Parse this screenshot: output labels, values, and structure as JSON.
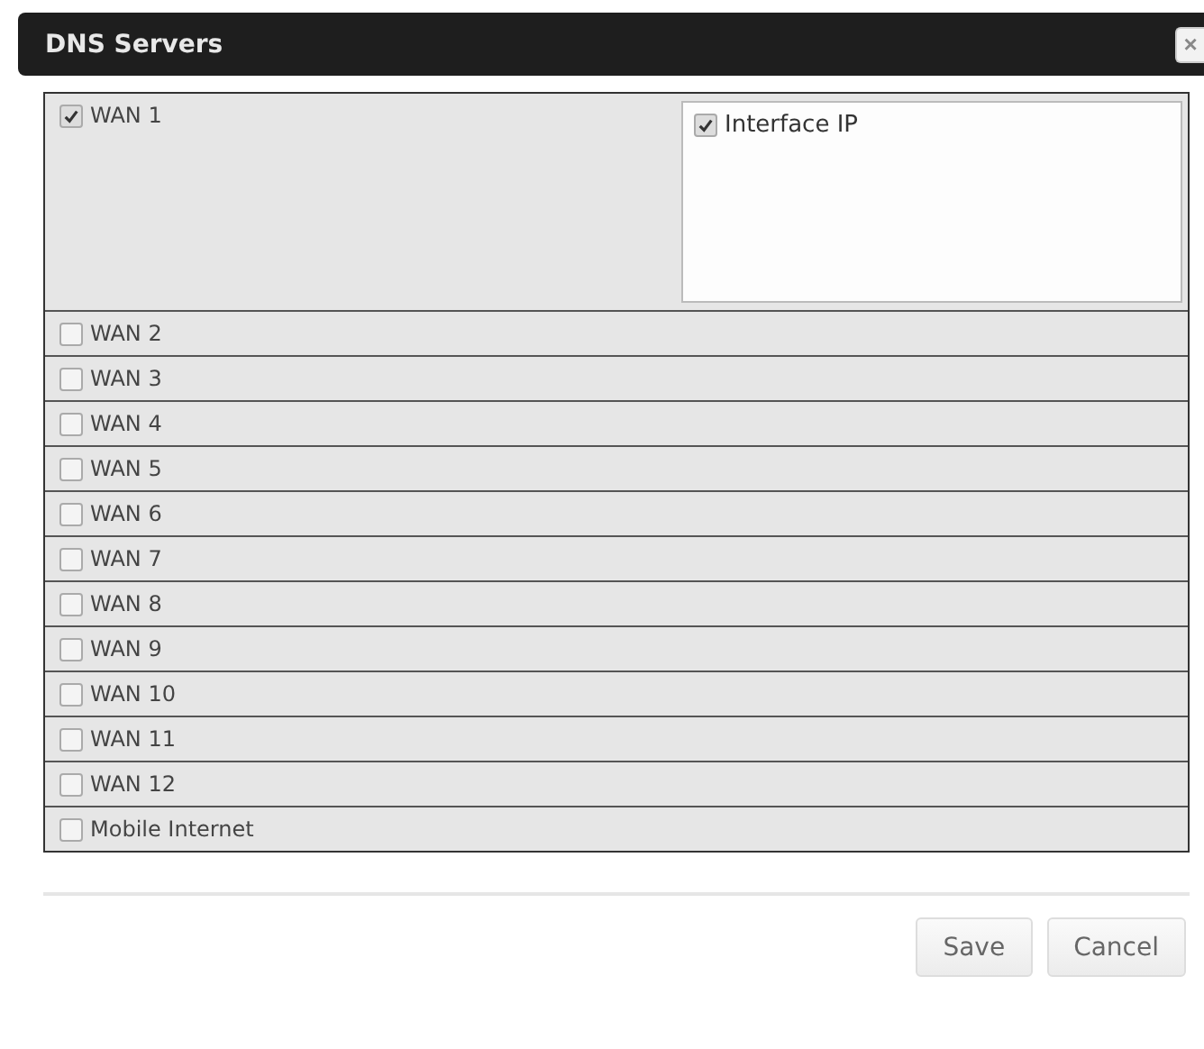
{
  "dialog": {
    "title": "DNS Servers",
    "close": "×"
  },
  "wans": [
    {
      "label": "WAN 1",
      "checked": true,
      "options": [
        {
          "label": "Interface IP",
          "checked": true
        }
      ]
    },
    {
      "label": "WAN 2",
      "checked": false
    },
    {
      "label": "WAN 3",
      "checked": false
    },
    {
      "label": "WAN 4",
      "checked": false
    },
    {
      "label": "WAN 5",
      "checked": false
    },
    {
      "label": "WAN 6",
      "checked": false
    },
    {
      "label": "WAN 7",
      "checked": false
    },
    {
      "label": "WAN 8",
      "checked": false
    },
    {
      "label": "WAN 9",
      "checked": false
    },
    {
      "label": "WAN 10",
      "checked": false
    },
    {
      "label": "WAN 11",
      "checked": false
    },
    {
      "label": "WAN 12",
      "checked": false
    },
    {
      "label": "Mobile Internet",
      "checked": false
    }
  ],
  "buttons": [
    "Save",
    "Cancel"
  ]
}
